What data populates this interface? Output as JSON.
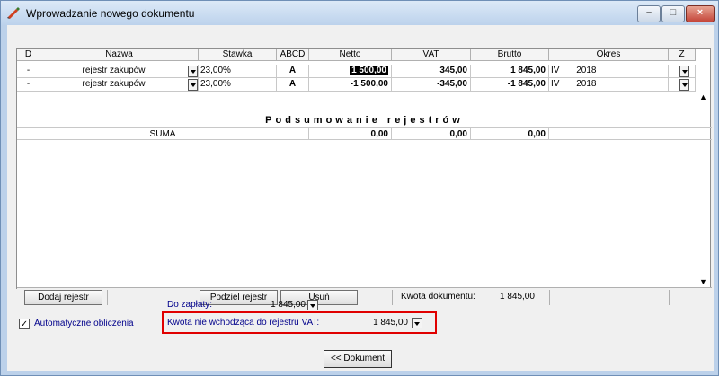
{
  "window": {
    "title": "Wprowadzanie nowego dokumentu",
    "min_label": "–",
    "max_label": "□",
    "close_label": "×"
  },
  "grid": {
    "headers": [
      "D",
      "Nazwa",
      "Stawka",
      "ABCD",
      "Netto",
      "VAT",
      "Brutto",
      "Okres",
      "Z"
    ],
    "rows": [
      {
        "d": "-",
        "nazwa": "rejestr zakupów",
        "stawka": "23,00%",
        "abcd": "A",
        "netto": "1 500,00",
        "vat": "345,00",
        "brutto": "1 845,00",
        "okres_m": "IV",
        "okres_y": "2018"
      },
      {
        "d": "-",
        "nazwa": "rejestr zakupów",
        "stawka": "23,00%",
        "abcd": "A",
        "netto": "-1 500,00",
        "vat": "-345,00",
        "brutto": "-1 845,00",
        "okres_m": "IV",
        "okres_y": "2018"
      }
    ],
    "summary_title": "Podsumowanie rejestrów",
    "summary": {
      "label": "SUMA",
      "netto": "0,00",
      "vat": "0,00",
      "brutto": "0,00"
    },
    "scroll_up": "▲",
    "scroll_down": "▼"
  },
  "buttons": {
    "add": "Dodaj rejestr",
    "split": "Podziel rejestr",
    "delete": "Usuń",
    "dokument": "<< Dokument"
  },
  "kwota_dokumentu": {
    "label": "Kwota dokumentu:",
    "value": "1 845,00"
  },
  "do_zaplaty": {
    "label": "Do zapłaty:",
    "value": "1 845,00"
  },
  "auto": {
    "label": "Automatyczne obliczenia",
    "checked_mark": "✓"
  },
  "kwota_vat": {
    "label": "Kwota nie wchodząca do rejestru VAT:",
    "value": "1 845,00"
  },
  "colors": {
    "highlight_border": "#e00000",
    "label_blue": "#00008b"
  }
}
